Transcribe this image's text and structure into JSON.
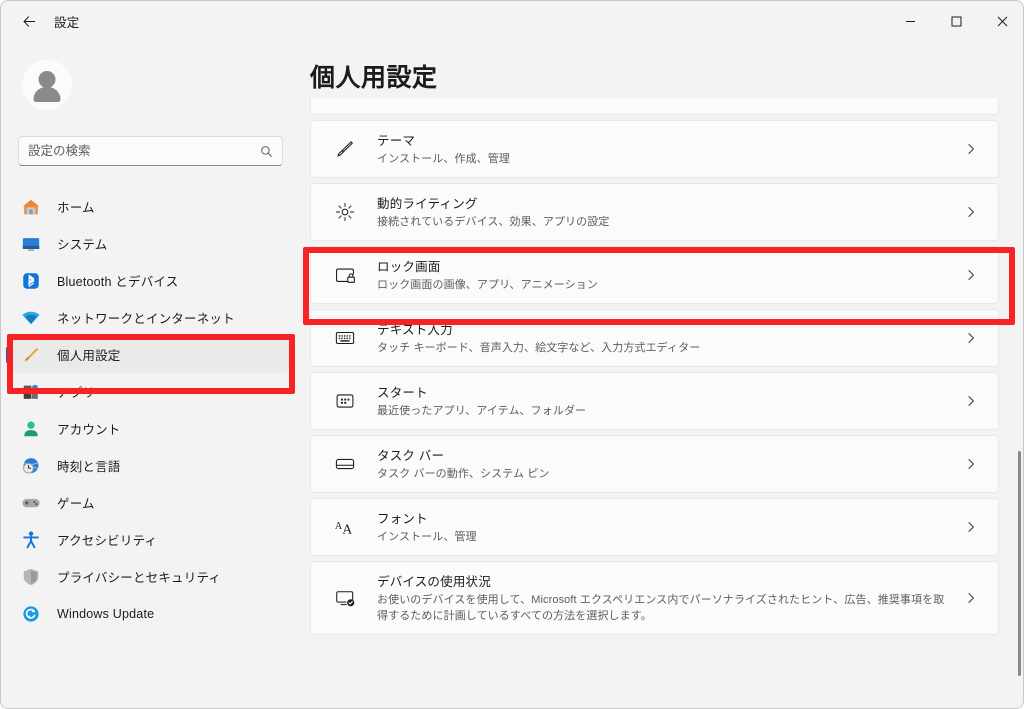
{
  "window": {
    "title": "設定",
    "back_icon": "back-arrow-icon",
    "minimize_label": "最小化",
    "maximize_label": "最大化",
    "close_label": "閉じる"
  },
  "sidebar": {
    "account_icon": "user-avatar-icon",
    "search": {
      "placeholder": "設定の検索",
      "value": "",
      "icon": "search-icon"
    },
    "items": [
      {
        "label": "ホーム",
        "icon": "home-icon",
        "selected": false
      },
      {
        "label": "システム",
        "icon": "monitor-icon",
        "selected": false
      },
      {
        "label": "Bluetooth とデバイス",
        "icon": "bluetooth-icon",
        "selected": false
      },
      {
        "label": "ネットワークとインターネット",
        "icon": "wifi-icon",
        "selected": false
      },
      {
        "label": "個人用設定",
        "icon": "paintbrush-icon",
        "selected": true
      },
      {
        "label": "アプリ",
        "icon": "apps-icon",
        "selected": false
      },
      {
        "label": "アカウント",
        "icon": "account-icon",
        "selected": false
      },
      {
        "label": "時刻と言語",
        "icon": "clock-globe-icon",
        "selected": false
      },
      {
        "label": "ゲーム",
        "icon": "gamepad-icon",
        "selected": false
      },
      {
        "label": "アクセシビリティ",
        "icon": "accessibility-icon",
        "selected": false
      },
      {
        "label": "プライバシーとセキュリティ",
        "icon": "shield-icon",
        "selected": false
      },
      {
        "label": "Windows Update",
        "icon": "update-icon",
        "selected": false
      }
    ]
  },
  "main": {
    "page_title": "個人用設定",
    "cards": [
      {
        "title": "テーマ",
        "subtitle": "インストール、作成、管理",
        "icon": "paintbrush-icon",
        "chevron": "chevron-right-icon",
        "highlighted": false
      },
      {
        "title": "動的ライティング",
        "subtitle": "接続されているデバイス、効果、アプリの設定",
        "icon": "dynamic-lighting-icon",
        "chevron": "chevron-right-icon",
        "highlighted": false
      },
      {
        "title": "ロック画面",
        "subtitle": "ロック画面の画像、アプリ、アニメーション",
        "icon": "lock-screen-icon",
        "chevron": "chevron-right-icon",
        "highlighted": true
      },
      {
        "title": "テキスト入力",
        "subtitle": "タッチ キーボード、音声入力、絵文字など、入力方式エディター",
        "icon": "keyboard-icon",
        "chevron": "chevron-right-icon",
        "highlighted": false
      },
      {
        "title": "スタート",
        "subtitle": "最近使ったアプリ、アイテム、フォルダー",
        "icon": "start-menu-icon",
        "chevron": "chevron-right-icon",
        "highlighted": false
      },
      {
        "title": "タスク バー",
        "subtitle": "タスク バーの動作、システム ピン",
        "icon": "taskbar-icon",
        "chevron": "chevron-right-icon",
        "highlighted": false
      },
      {
        "title": "フォント",
        "subtitle": "インストール、管理",
        "icon": "font-aa-icon",
        "chevron": "chevron-right-icon",
        "highlighted": false
      },
      {
        "title": "デバイスの使用状況",
        "subtitle": "お使いのデバイスを使用して、Microsoft エクスペリエンス内でパーソナライズされたヒント、広告、推奨事項を取得するために計画しているすべての方法を選択します。",
        "icon": "device-usage-icon",
        "chevron": "chevron-right-icon",
        "highlighted": false
      }
    ]
  },
  "annotations": {
    "color": "#f52323",
    "boxes": [
      {
        "target": "sidebar-item-personalization"
      },
      {
        "target": "card-lock-screen"
      }
    ]
  }
}
